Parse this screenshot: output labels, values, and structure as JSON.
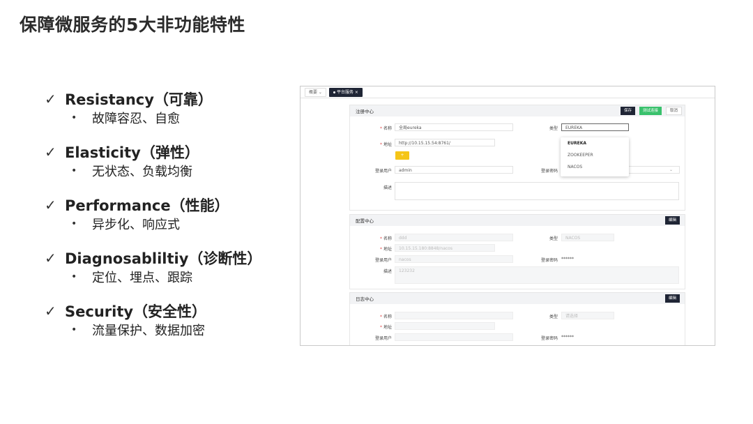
{
  "slide": {
    "title": "保障微服务的5大非功能特性",
    "check_glyph": "✓",
    "bullet_glyph": "•",
    "features": [
      {
        "name": "Resistancy（可靠）",
        "detail": "故障容忍、自愈"
      },
      {
        "name": "Elasticity（弹性）",
        "detail": "无状态、负载均衡"
      },
      {
        "name": "Performance（性能）",
        "detail": "异步化、响应式"
      },
      {
        "name": "Diagnosabliltiy（诊断性）",
        "detail": "定位、埋点、跟踪"
      },
      {
        "name": "Security（安全性）",
        "detail": "流量保护、数据加密"
      }
    ]
  },
  "ui": {
    "tabs": [
      "概要",
      "平台服务"
    ],
    "registry": {
      "title": "注册中心",
      "save": "保存",
      "test": "测试连接",
      "cancel": "取消",
      "name_label": "名称",
      "name_value": "全局eureka",
      "type_label": "类型",
      "type_value": "EUREKA",
      "address_label": "地址",
      "address_value": "http://10.15.15.54:8761/",
      "plus": "+",
      "user_label": "登录用户",
      "user_value": "admin",
      "password_label": "登录密码",
      "desc_label": "描述",
      "type_options": [
        "EUREKA",
        "ZOOKEEPER",
        "NACOS"
      ]
    },
    "config": {
      "title": "配置中心",
      "edit": "编辑",
      "name_label": "名称",
      "name_value": "ddd",
      "type_label": "类型",
      "type_value": "NACOS",
      "address_label": "地址",
      "address_value": "10.15.15.180:8848/nacos",
      "user_label": "登录用户",
      "user_value": "nacos",
      "password_label": "登录密码",
      "password_value": "******",
      "desc_label": "描述",
      "desc_value": "123232"
    },
    "log": {
      "title": "日志中心",
      "edit": "编辑",
      "name_label": "名称",
      "type_label": "类型",
      "type_value": "请选择",
      "address_label": "地址",
      "user_label": "登录用户",
      "password_label": "登录密码",
      "password_value": "******"
    }
  }
}
